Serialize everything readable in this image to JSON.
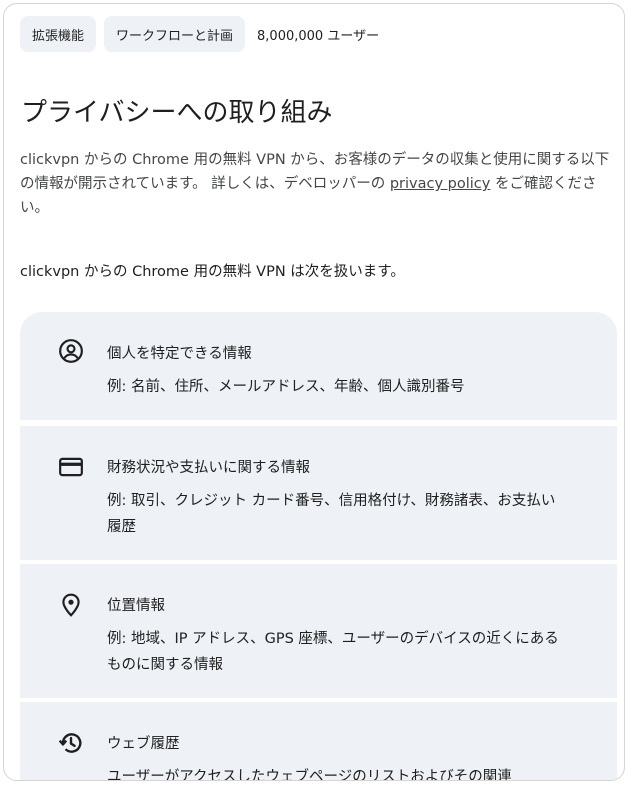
{
  "header": {
    "chips": [
      {
        "label": "拡張機能"
      },
      {
        "label": "ワークフローと計画"
      }
    ],
    "users": "8,000,000 ユーザー"
  },
  "title": "プライバシーへの取り組み",
  "intro": {
    "text_before": "clickvpn からの Chrome 用の無料 VPN から、お客様のデータの収集と使用に関する以下の情報が開示されています。 詳しくは、デベロッパーの ",
    "link": "privacy policy",
    "text_after": " をご確認ください。"
  },
  "handles_heading": "clickvpn からの Chrome 用の無料 VPN は次を扱います。",
  "categories": [
    {
      "icon": "account-circle-icon",
      "label": "個人を特定できる情報",
      "desc": "例: 名前、住所、メールアドレス、年齢、個人識別番号"
    },
    {
      "icon": "credit-card-icon",
      "label": "財務状況や支払いに関する情報",
      "desc": "例: 取引、クレジット カード番号、信用格付け、財務諸表、お支払い履歴"
    },
    {
      "icon": "location-pin-icon",
      "label": "位置情報",
      "desc": "例: 地域、IP アドレス、GPS 座標、ユーザーのデバイスの近くにあるものに関する情報"
    },
    {
      "icon": "history-icon",
      "label": "ウェブ履歴",
      "desc": "ユーザーがアクセスしたウェブページのリストおよびその関連"
    }
  ]
}
